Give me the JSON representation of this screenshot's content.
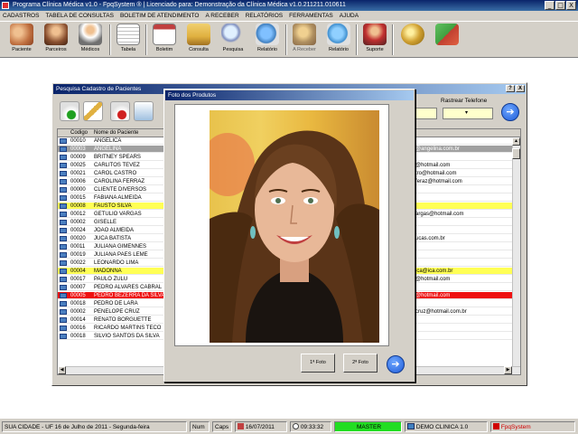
{
  "window": {
    "title": "Programa Clínica Médica v1.0 - FpqSystem ® | Licenciado para: Demonstração da Clínica Médica v1.0.211211.010611",
    "minimize": "_",
    "maximize": "□",
    "close": "X"
  },
  "menu": [
    "CADASTROS",
    "TABELA DE CONSULTAS",
    "BOLETIM DE ATENDIMENTO",
    "A RECEBER",
    "RELATÓRIOS",
    "FERRAMENTAS",
    "AJUDA"
  ],
  "toolbar": [
    {
      "label": "Paciente",
      "icon": "patients-icon",
      "color": "#c07040"
    },
    {
      "label": "Parceiros",
      "icon": "partners-icon",
      "color": "#8a5030"
    },
    {
      "label": "Médicos",
      "icon": "doctor-icon",
      "color": "#707070"
    },
    {
      "label": "Tabela",
      "icon": "table-icon",
      "color": "#e0e0e0"
    },
    {
      "label": "Boletim",
      "icon": "calendar-icon",
      "color": "#c04040"
    },
    {
      "label": "Consulta",
      "icon": "folder-icon",
      "color": "#e0b040"
    },
    {
      "label": "Pesquisa",
      "icon": "magnifier-icon",
      "color": "#8090c0"
    },
    {
      "label": "Relatório",
      "icon": "globe-report-icon",
      "color": "#4080c0"
    },
    {
      "label": "A Receber",
      "icon": "receivable-icon",
      "color": "#b09060"
    },
    {
      "label": "Relatório",
      "icon": "globe-report-icon",
      "color": "#4090d0"
    },
    {
      "label": "Suporte",
      "icon": "support-icon",
      "color": "#c03030"
    },
    {
      "label": "",
      "icon": "coins-icon",
      "color": "#d0a030"
    },
    {
      "label": "",
      "icon": "exit-icon",
      "color": "#40a040"
    }
  ],
  "pesquisa_dialog": {
    "title": "Pesquisa Cadastro de Pacientes",
    "help": "?",
    "close": "X",
    "rastrear_label": "Rastrear Telefone",
    "columns": [
      "Codigo",
      "Nome do Paciente"
    ],
    "rows": [
      {
        "codigo": "00010",
        "nome": "ANGELICA",
        "email": "",
        "style": "normal"
      },
      {
        "codigo": "00003",
        "nome": "ANGELINA",
        "email": "@angelina.com.br",
        "style": "gray"
      },
      {
        "codigo": "00009",
        "nome": "BRITNEY SPEARS",
        "email": "",
        "style": "normal"
      },
      {
        "codigo": "00025",
        "nome": "CARLITOS TEVEZ",
        "email": "@hotmail.com",
        "style": "normal"
      },
      {
        "codigo": "00021",
        "nome": "CAROL CASTRO",
        "email": "tro@hotmail.com",
        "style": "normal"
      },
      {
        "codigo": "00006",
        "nome": "CAROLINA FERRAZ",
        "email": "feraz@hotmail.com",
        "style": "normal"
      },
      {
        "codigo": "00000",
        "nome": "CLIENTE DIVERSOS",
        "email": "",
        "style": "normal"
      },
      {
        "codigo": "00015",
        "nome": "FABIANA ALMEIDA",
        "email": "",
        "style": "normal"
      },
      {
        "codigo": "00008",
        "nome": "FAUSTO SILVA",
        "email": "",
        "style": "yellow"
      },
      {
        "codigo": "00012",
        "nome": "GETULIO VARGAS",
        "email": "argas@hotmail.com",
        "style": "normal"
      },
      {
        "codigo": "00002",
        "nome": "GISELLE",
        "email": "",
        "style": "normal"
      },
      {
        "codigo": "00024",
        "nome": "JOAO ALMEIDA",
        "email": "",
        "style": "normal"
      },
      {
        "codigo": "00020",
        "nome": "JUCA BATISTA",
        "email": "ucas.com.br",
        "style": "normal"
      },
      {
        "codigo": "00011",
        "nome": "JULIANA GIMENNES",
        "email": "",
        "style": "normal"
      },
      {
        "codigo": "00019",
        "nome": "JULIANA PAES LEME",
        "email": "",
        "style": "normal"
      },
      {
        "codigo": "00022",
        "nome": "LEONARDO LIMA",
        "email": "",
        "style": "normal"
      },
      {
        "codigo": "00004",
        "nome": "MADONNA",
        "email": "ica@ica.com.br",
        "style": "yellow"
      },
      {
        "codigo": "00017",
        "nome": "PAULO ZULU",
        "email": "@hotmail.com",
        "style": "normal"
      },
      {
        "codigo": "00007",
        "nome": "PEDRO ALVARES CABRAL",
        "email": "",
        "style": "normal"
      },
      {
        "codigo": "00005",
        "nome": "PEDRO BEZERRA DA SILVA",
        "email": "@hotmail.com",
        "style": "red"
      },
      {
        "codigo": "00018",
        "nome": "PEDRO DE LARA",
        "email": "",
        "style": "normal"
      },
      {
        "codigo": "00002",
        "nome": "PENELOPE CRUZ",
        "email": "cruz@hotmail.com.br",
        "style": "normal"
      },
      {
        "codigo": "00014",
        "nome": "RENATO BORGUETTE",
        "email": "",
        "style": "normal"
      },
      {
        "codigo": "00016",
        "nome": "RICARDO MARTINS TECO",
        "email": "",
        "style": "normal"
      },
      {
        "codigo": "00018",
        "nome": "SILVIO SANTOS DA SILVA",
        "email": "",
        "style": "normal"
      }
    ]
  },
  "foto_dialog": {
    "title": "Foto dos Produtos",
    "btn_foto1": "1ª Foto",
    "btn_foto2": "2ª Foto"
  },
  "status": {
    "city": "SUA CIDADE - UF 16 de Julho de 2011 - Segunda-feira",
    "num": "Num",
    "caps": "Caps",
    "date": "16/07/2011",
    "time": "09:33:32",
    "user": "MASTER",
    "product": "DEMO CLINICA 1.0",
    "brand": "FpqSystem"
  },
  "colors": {
    "status_green": "#22dd22",
    "brand_red": "#d00000"
  }
}
